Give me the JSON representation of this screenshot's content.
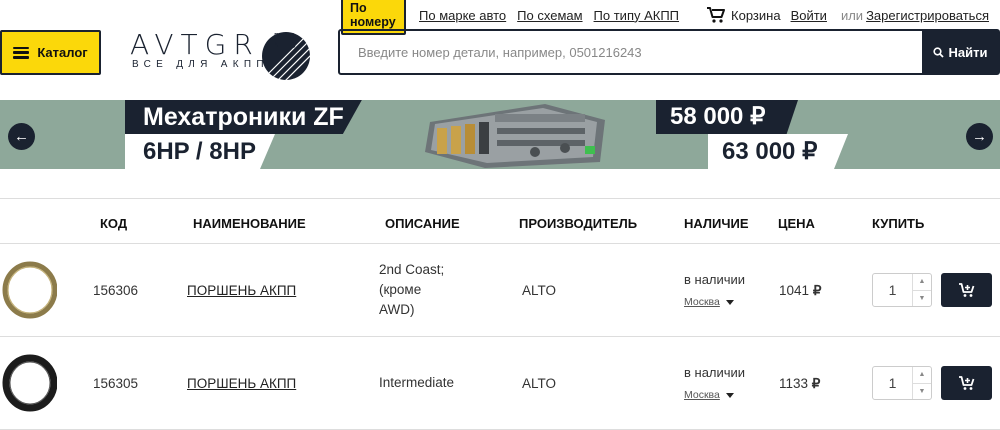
{
  "header": {
    "catalog_label": "Каталог",
    "logo_word": "AVTGR",
    "logo_tagline": "ВСЕ ДЛЯ АКПП",
    "logo_mark": "P R N D",
    "nav": {
      "by_number": "По номеру",
      "by_brand": "По марке авто",
      "by_schemes": "По схемам",
      "by_type": "По типу АКПП",
      "cart": "Корзина",
      "login": "Войти",
      "or": "или",
      "register": "Зарегистрироваться"
    },
    "search": {
      "placeholder": "Введите номер детали, например, 0501216243",
      "button": "Найти"
    }
  },
  "banner": {
    "title": "Мехатроники ZF",
    "subtitle": "6HP / 8HP",
    "price_1": "58 000 ₽",
    "price_2": "63 000 ₽"
  },
  "table": {
    "headers": {
      "code": "КОД",
      "name": "НАИМЕНОВАНИЕ",
      "description": "ОПИСАНИЕ",
      "maker": "ПРОИЗВОДИТЕЛЬ",
      "availability": "НАЛИЧИЕ",
      "price": "ЦЕНА",
      "buy": "КУПИТЬ"
    },
    "rows": [
      {
        "code": "156306",
        "name": "ПОРШЕНЬ АКПП",
        "description_lines": [
          "2nd Coast;",
          "(кроме",
          "AWD)"
        ],
        "maker": "ALTO",
        "availability": "в наличии",
        "city": "Москва",
        "price": "1041",
        "currency": "₽",
        "qty": "1"
      },
      {
        "code": "156305",
        "name": "ПОРШЕНЬ АКПП",
        "description_lines": [
          "Intermediate"
        ],
        "maker": "ALTO",
        "availability": "в наличии",
        "city": "Москва",
        "price": "1133",
        "currency": "₽",
        "qty": "1"
      }
    ]
  },
  "colors": {
    "accent_yellow": "#fbd80a",
    "navy": "#1a2230",
    "banner_bg": "#8ea89a"
  }
}
